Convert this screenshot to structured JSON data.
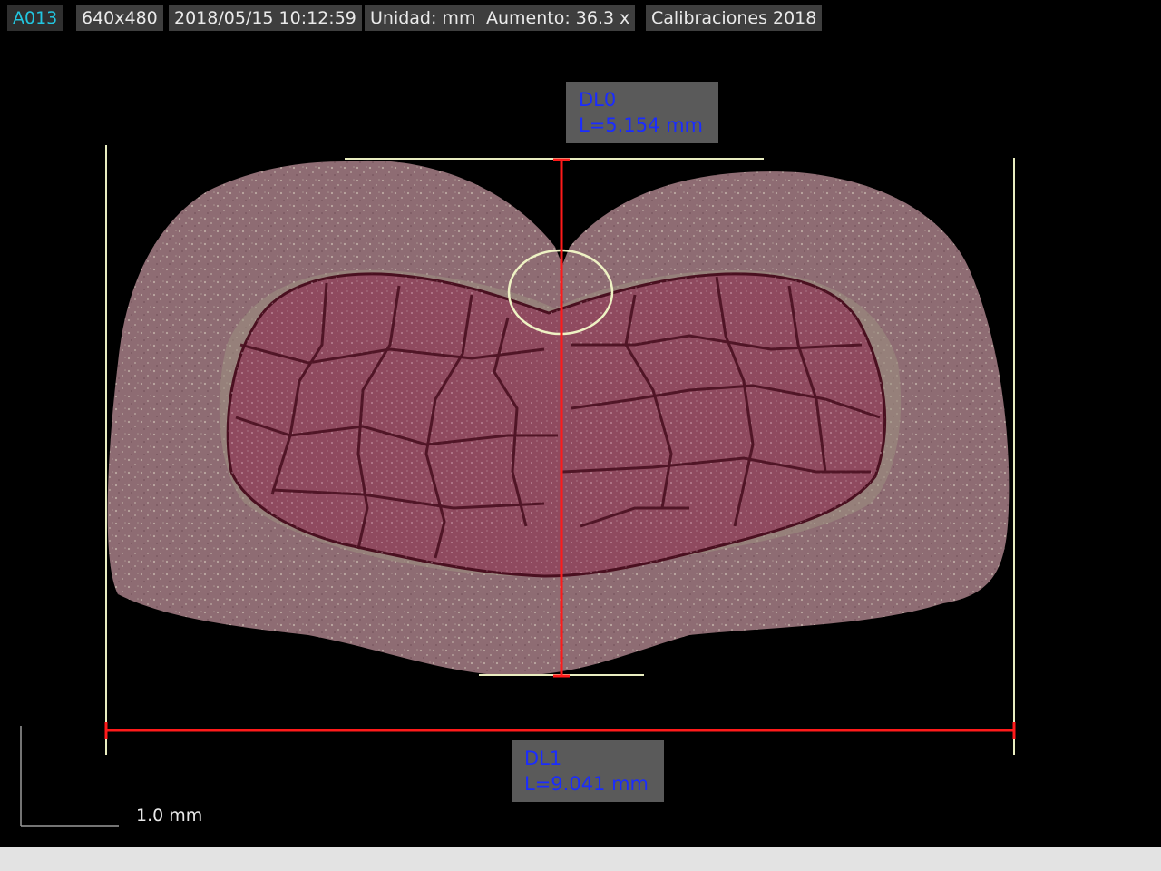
{
  "header": {
    "image_id": "A013",
    "resolution": "640x480",
    "datetime": "2018/05/15 10:12:59",
    "unit": "Unidad: mm",
    "magnification": "Aumento:  36.3 x",
    "calibration": "Calibraciones 2018"
  },
  "measurements": [
    {
      "name": "DL0",
      "length": "L=5.154 mm"
    },
    {
      "name": "DL1",
      "length": "L=9.041 mm"
    }
  ],
  "scale_bar": {
    "label": "1.0 mm"
  },
  "colors": {
    "measure_line": "#ff1a1a",
    "guide_line": "#e9edc0",
    "label_text": "#1a2cff",
    "id_text": "#22c6e0",
    "specimen_outer": "#8e6c73",
    "specimen_inner": "#8f4a5f",
    "grain_boundary": "#4a1020"
  },
  "icons": {
    "annotation": "ellipse-marker-icon"
  }
}
